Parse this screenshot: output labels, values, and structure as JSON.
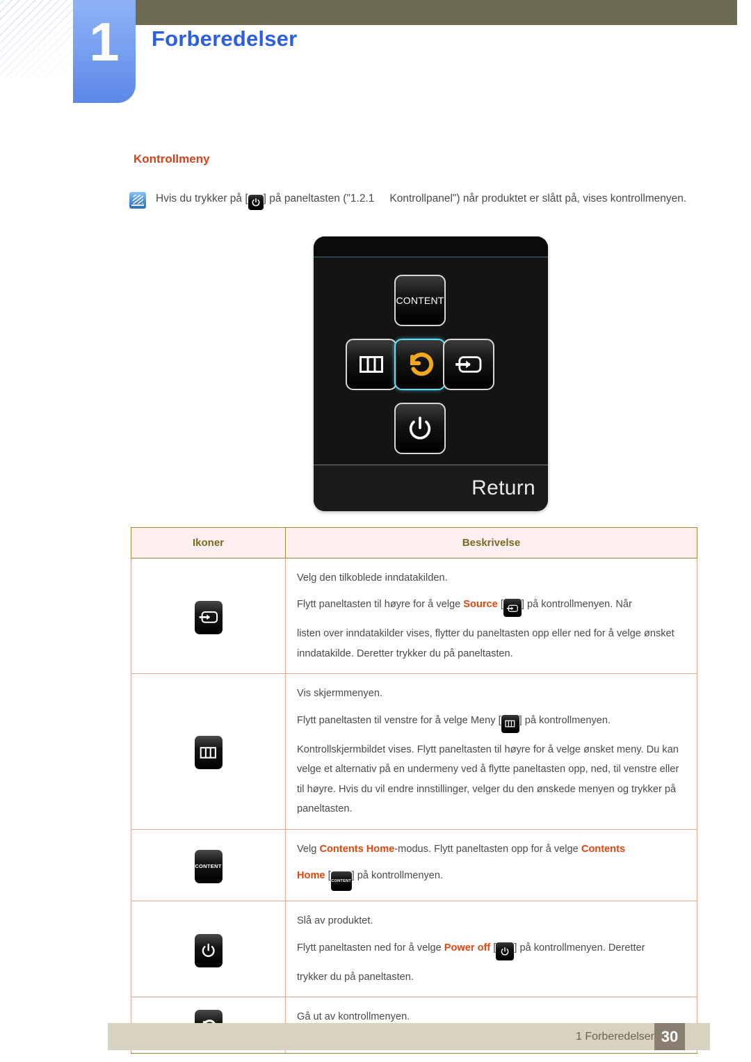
{
  "header": {
    "chapter_number": "1",
    "chapter_title": "Forberedelser"
  },
  "section": {
    "title": "Kontrollmeny",
    "note_icon": "note-pencil-icon",
    "note_text_part1": "Hvis du trykker på [",
    "note_key_icon": "power-icon",
    "note_text_part2": "] på paneltasten (\"1.2.1",
    "note_text_part3": "Kontrollpanel\") når produktet er slått på, vises kontrollmenyen."
  },
  "device": {
    "buttons": {
      "content": {
        "label": "CONTENT",
        "icon": "content-button"
      },
      "menu": {
        "label": "",
        "icon": "menu-icon"
      },
      "return": {
        "label": "",
        "icon": "return-arrow-icon",
        "selected": true
      },
      "source": {
        "label": "",
        "icon": "source-input-icon"
      },
      "power": {
        "label": "",
        "icon": "power-icon"
      }
    },
    "footer_label": "Return",
    "highlight_color": "#5fe0f5"
  },
  "table": {
    "headers": [
      "Ikoner",
      "Beskrivelse"
    ],
    "rows": [
      {
        "icon": "source-input-icon",
        "lines": [
          {
            "segments": [
              {
                "t": "Velg den tilkoblede inndatakilden."
              }
            ]
          },
          {
            "segments": [
              {
                "t": "Flytt paneltasten til høyre for å velge "
              },
              {
                "t": "Source",
                "hl": true
              },
              {
                "t": " ["
              },
              {
                "icon": "source-input-icon"
              },
              {
                "t": "] på kontrollmenyen. Når"
              }
            ]
          },
          {
            "segments": [
              {
                "t": "listen over inndatakilder vises, flytter du paneltasten opp eller ned for å velge ønsket inndatakilde. Deretter trykker du på paneltasten."
              }
            ]
          }
        ]
      },
      {
        "icon": "menu-icon",
        "lines": [
          {
            "segments": [
              {
                "t": "Vis skjermmenyen."
              }
            ]
          },
          {
            "segments": [
              {
                "t": "Flytt paneltasten til venstre for å velge Meny ["
              },
              {
                "icon": "menu-icon"
              },
              {
                "t": "] på kontrollmenyen."
              }
            ]
          },
          {
            "segments": [
              {
                "t": "Kontrollskjermbildet vises. Flytt paneltasten til høyre for å velge ønsket meny. Du kan velge et alternativ på en undermeny ved å flytte paneltasten opp, ned, til venstre eller til høyre. Hvis du vil endre innstillinger, velger du den ønskede menyen og trykker på paneltasten."
              }
            ]
          }
        ]
      },
      {
        "icon": "content-button",
        "lines": [
          {
            "segments": [
              {
                "t": "Velg "
              },
              {
                "t": "Contents Home",
                "hl": true
              },
              {
                "t": "-modus. Flytt paneltasten opp for å velge "
              },
              {
                "t": "Contents",
                "hl": true
              }
            ]
          },
          {
            "segments": [
              {
                "t": "Home",
                "hl": true
              },
              {
                "t": " ["
              },
              {
                "icon": "content-button"
              },
              {
                "t": "] på kontrollmenyen."
              }
            ]
          }
        ]
      },
      {
        "icon": "power-icon",
        "lines": [
          {
            "segments": [
              {
                "t": "Slå av produktet."
              }
            ]
          },
          {
            "segments": [
              {
                "t": "Flytt paneltasten ned for å velge "
              },
              {
                "t": "Power off",
                "hl": true
              },
              {
                "t": " ["
              },
              {
                "icon": "power-icon"
              },
              {
                "t": "] på kontrollmenyen. Deretter"
              }
            ]
          },
          {
            "segments": [
              {
                "t": "trykker du på paneltasten."
              }
            ]
          }
        ]
      },
      {
        "icon": "return-arrow-icon",
        "lines": [
          {
            "segments": [
              {
                "t": "Gå ut av kontrollmenyen."
              }
            ]
          }
        ]
      }
    ]
  },
  "footer": {
    "label": "1 Forberedelser",
    "page_number": "30"
  },
  "colors": {
    "chapter_title": "#2b5fe0",
    "section_title": "#d4421a",
    "highlight": "#e0460f",
    "table_border": "#9a8a3a",
    "table_inner_border": "#e8a48c",
    "table_header_bg": "#fdeff0",
    "header_bar": "#6e6b53",
    "footer_bar": "#d8d3c0",
    "page_badge": "#8a7e72"
  }
}
